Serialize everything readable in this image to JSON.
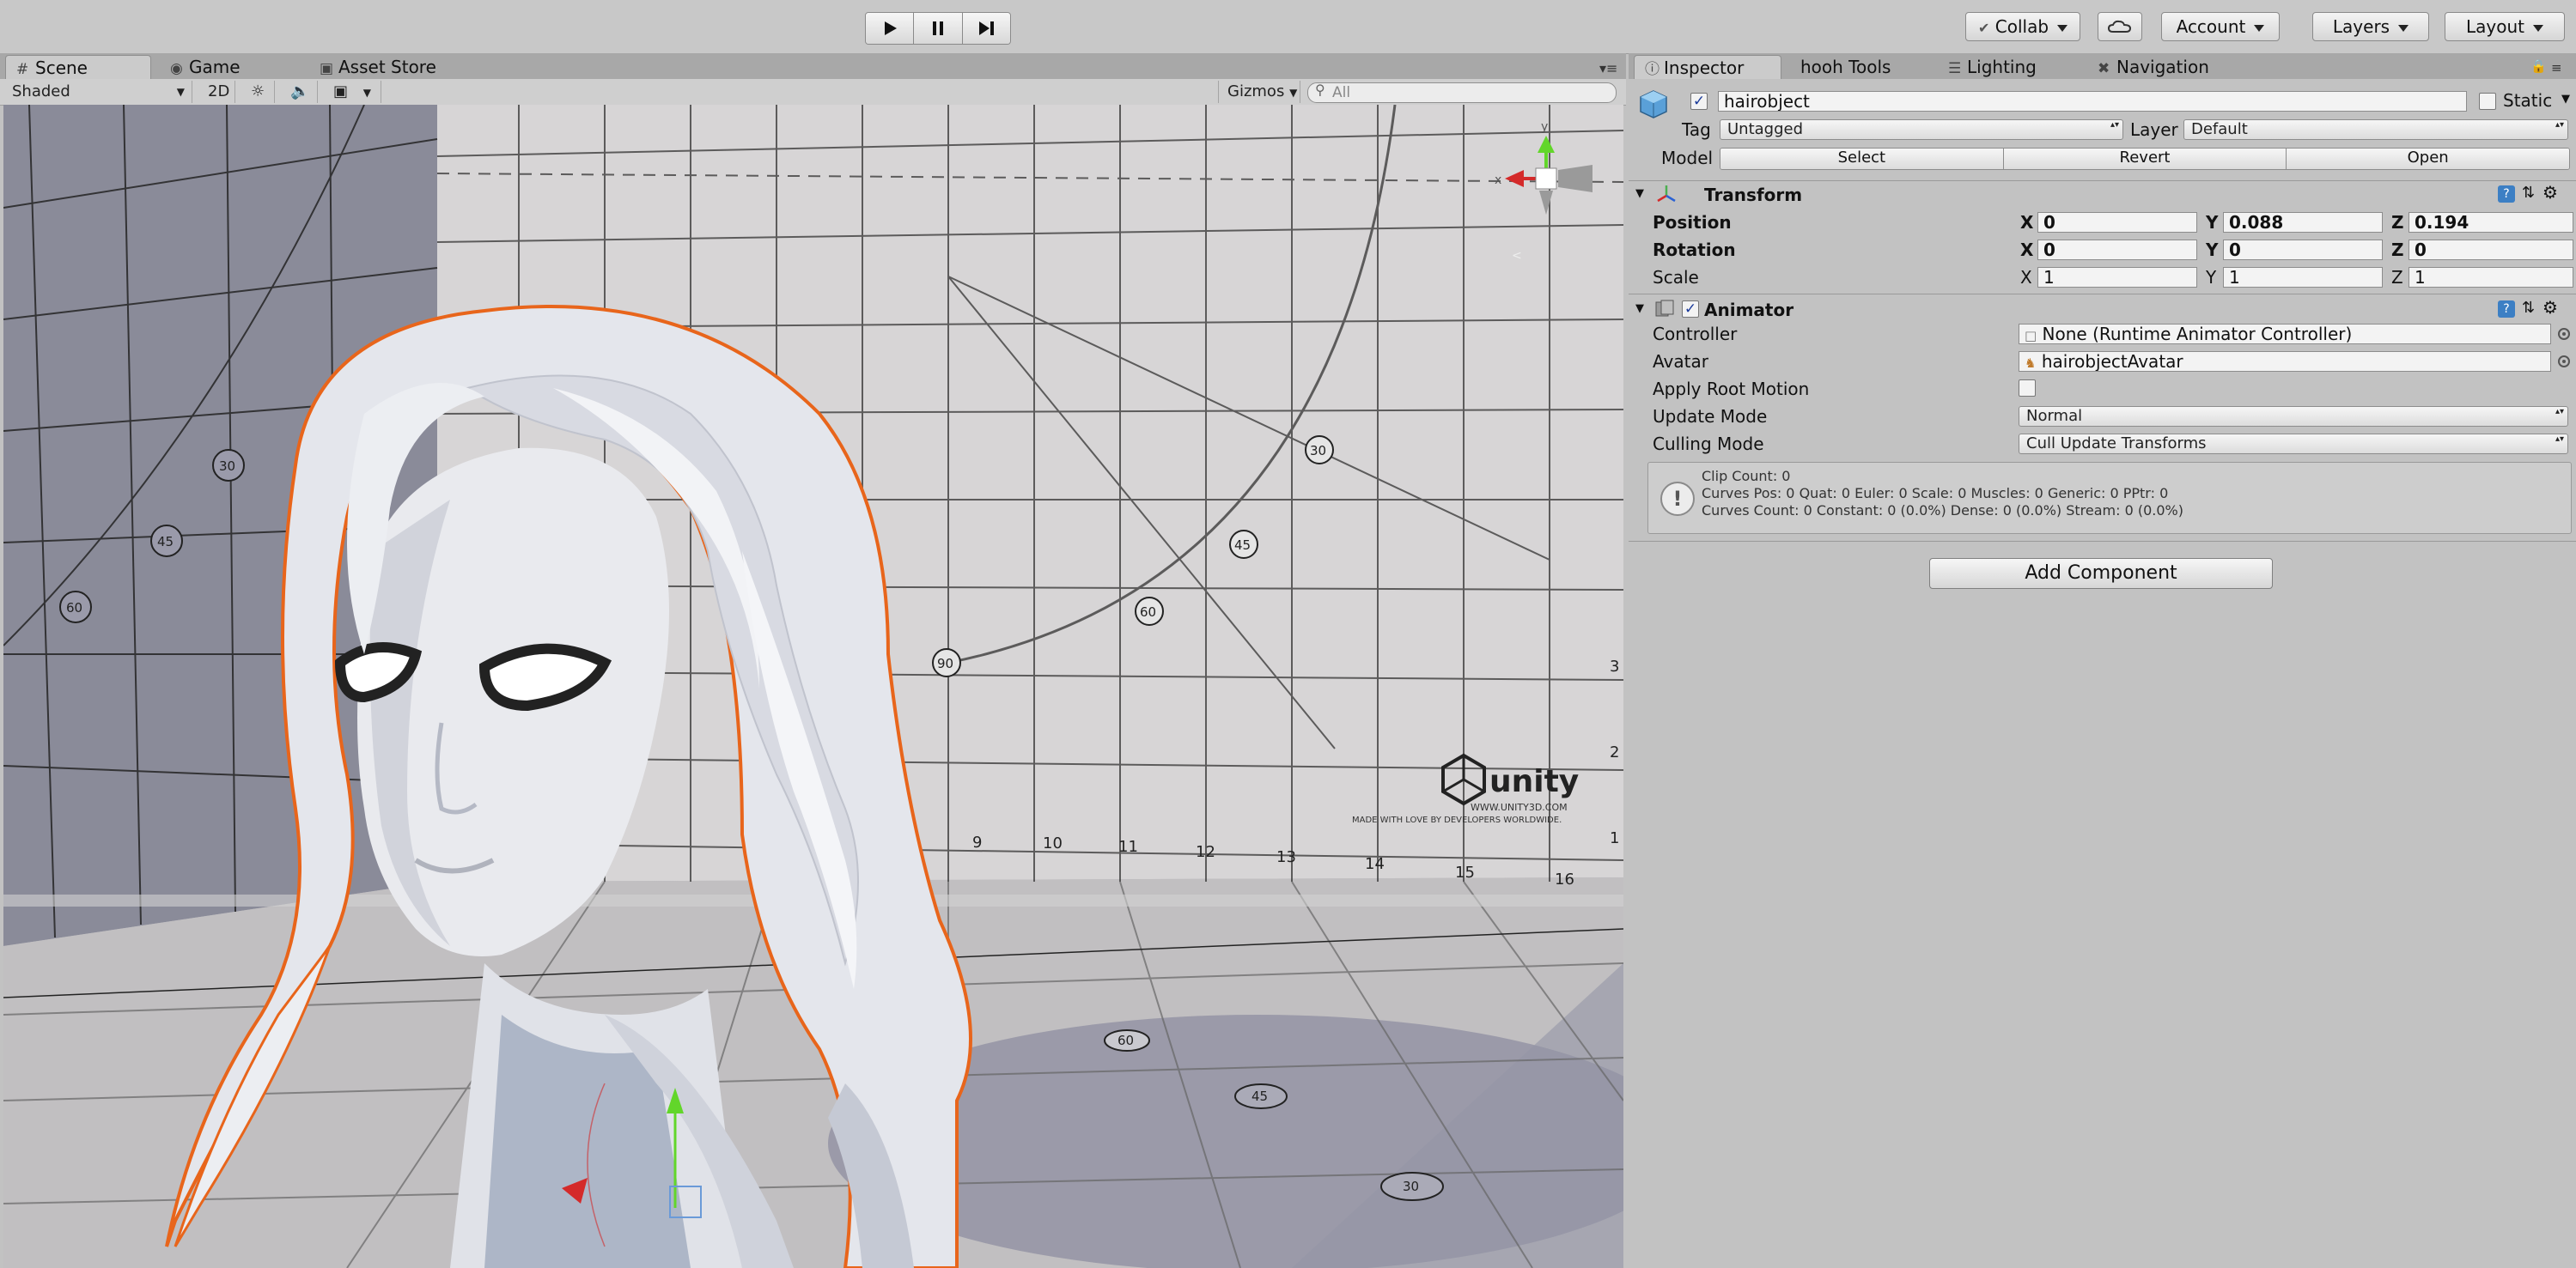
{
  "toolbar": {
    "collab": "Collab",
    "account": "Account",
    "layers": "Layers",
    "layout": "Layout"
  },
  "scene_tabs": [
    "Scene",
    "Game",
    "Asset Store"
  ],
  "scene_bar": {
    "shading_mode": "Shaded",
    "mode_2d": "2D",
    "gizmos": "Gizmos",
    "search_placeholder": "All"
  },
  "viewport": {
    "grid_numbers_back": [
      "9",
      "10",
      "11",
      "12",
      "13",
      "14",
      "15",
      "16"
    ],
    "grid_numbers_left": [
      "60",
      "45",
      "30"
    ],
    "angle_marks": [
      "90",
      "60",
      "45",
      "30"
    ],
    "right_wall_numbers": [
      "3",
      "2",
      "1"
    ],
    "logo_text": "unity",
    "logo_url": "WWW.UNITY3D.COM",
    "logo_tagline": "MADE WITH LOVE BY DEVELOPERS WORLDWIDE.",
    "gizmo_axis_y": "y",
    "gizmo_axis_x": "x",
    "floor_marks": [
      "60",
      "45",
      "30"
    ]
  },
  "inspector_tabs": [
    "Inspector",
    "hooh Tools",
    "Lighting",
    "Navigation"
  ],
  "object": {
    "name": "hairobject",
    "static_label": "Static",
    "tag_label": "Tag",
    "tag_value": "Untagged",
    "layer_label": "Layer",
    "layer_value": "Default",
    "model_label": "Model",
    "model_buttons": [
      "Select",
      "Revert",
      "Open"
    ]
  },
  "transform": {
    "title": "Transform",
    "rows": [
      {
        "label": "Position",
        "x": "0",
        "y": "0.088",
        "z": "0.194",
        "bold": true
      },
      {
        "label": "Rotation",
        "x": "0",
        "y": "0",
        "z": "0",
        "bold": true
      },
      {
        "label": "Scale",
        "x": "1",
        "y": "1",
        "z": "1",
        "bold": false
      }
    ],
    "axis_labels": [
      "X",
      "Y",
      "Z"
    ]
  },
  "animator": {
    "title": "Animator",
    "controller_label": "Controller",
    "controller_value": "None (Runtime Animator Controller)",
    "avatar_label": "Avatar",
    "avatar_value": "hairobjectAvatar",
    "apply_root_motion_label": "Apply Root Motion",
    "update_mode_label": "Update Mode",
    "update_mode_value": "Normal",
    "culling_mode_label": "Culling Mode",
    "culling_mode_value": "Cull Update Transforms",
    "info_lines": [
      "Clip Count: 0",
      "Curves Pos: 0 Quat: 0 Euler: 0 Scale: 0 Muscles: 0 Generic: 0 PPtr: 0",
      "Curves Count: 0 Constant: 0 (0.0%) Dense: 0 (0.0%) Stream: 0 (0.0%)"
    ]
  },
  "add_component": "Add Component",
  "colors": {
    "selection_outline": "#e8651b",
    "gizmo_x": "#d42a2a",
    "gizmo_y": "#62d62a",
    "panel_bg": "#c2c2c2"
  }
}
